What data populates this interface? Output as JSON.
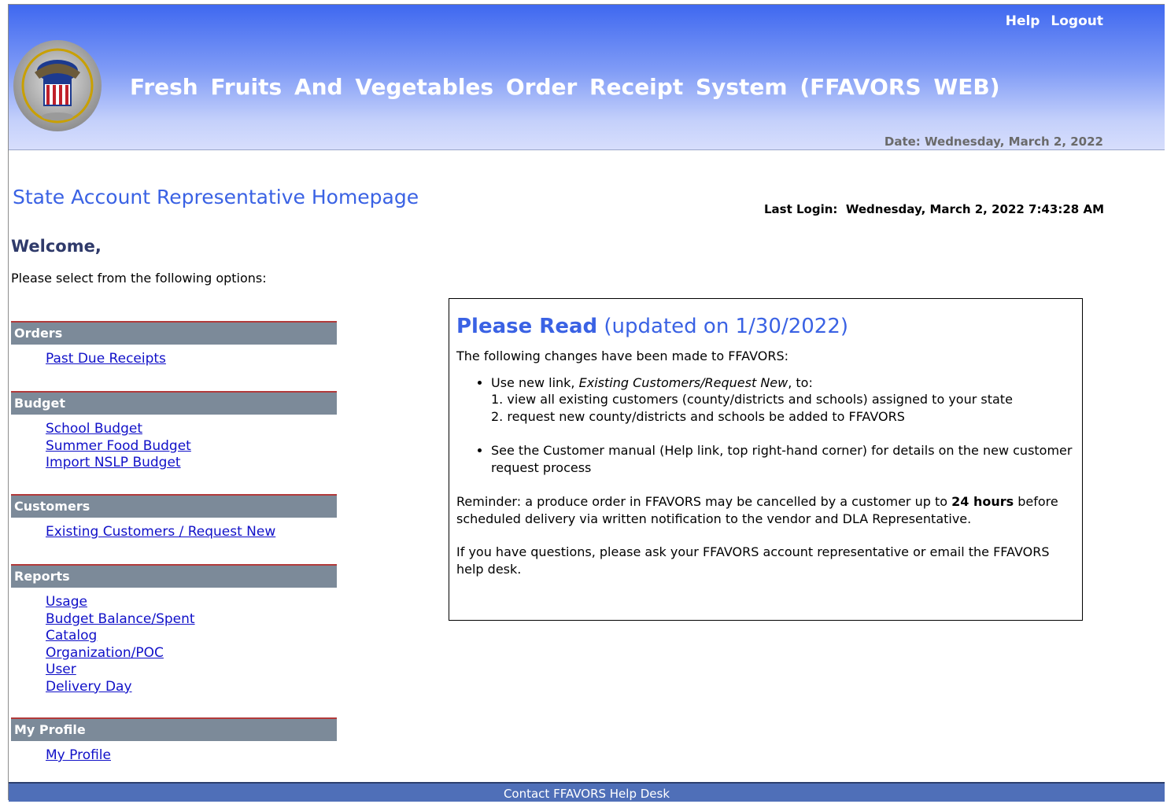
{
  "header": {
    "links": {
      "help": "Help",
      "logout": "Logout"
    },
    "title": "Fresh Fruits And Vegetables Order Receipt System (FFAVORS WEB)",
    "date": "Date: Wednesday, March 2, 2022"
  },
  "page": {
    "title": "State Account Representative Homepage",
    "last_login_label": "Last Login:",
    "last_login_value": "Wednesday, March 2, 2022 7:43:28 AM",
    "welcome": "Welcome,",
    "select_prompt": "Please select from the following options:"
  },
  "nav": {
    "orders": {
      "heading": "Orders",
      "items": [
        "Past Due Receipts"
      ]
    },
    "budget": {
      "heading": "Budget",
      "items": [
        "School Budget",
        "Summer Food Budget",
        "Import NSLP Budget"
      ]
    },
    "customers": {
      "heading": "Customers",
      "items": [
        "Existing Customers / Request New"
      ]
    },
    "reports": {
      "heading": "Reports",
      "items": [
        "Usage",
        "Budget Balance/Spent",
        "Catalog",
        "Organization/POC",
        "User",
        "Delivery Day"
      ]
    },
    "profile": {
      "heading": "My Profile",
      "items": [
        "My Profile"
      ]
    }
  },
  "notice": {
    "heading_bold": "Please Read",
    "heading_rest": " (updated on 1/30/2022)",
    "intro": "The following changes have been made to FFAVORS:",
    "bullet1_pre": "Use new link, ",
    "bullet1_em": "Existing Customers/Request New",
    "bullet1_post": ", to:",
    "sub1": "1. view all existing customers (county/districts and schools) assigned to your state",
    "sub2": "2. request new county/districts and schools be added to FFAVORS",
    "bullet2": "See the Customer manual (Help link, top right-hand corner) for details on the new customer request process",
    "reminder_pre": "Reminder: a produce order in FFAVORS may be cancelled by a customer up to ",
    "reminder_bold": "24 hours",
    "reminder_post": " before scheduled delivery via written notification to the vendor and DLA Representative.",
    "questions": "If you have questions, please ask your FFAVORS account representative or email the FFAVORS help desk."
  },
  "footer": {
    "text": "Contact FFAVORS Help Desk"
  }
}
